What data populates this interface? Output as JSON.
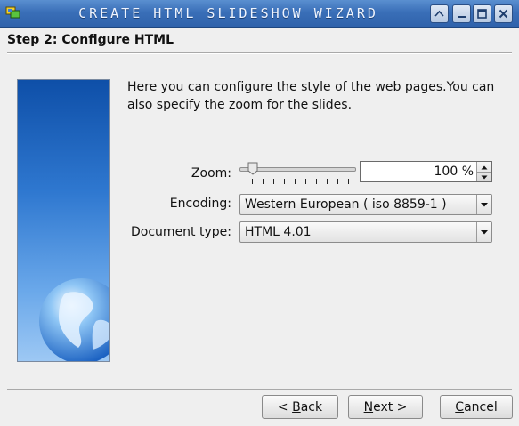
{
  "window": {
    "title": "Create HTML Slideshow Wizard",
    "controls": [
      "shade",
      "minimize",
      "maximize",
      "close"
    ]
  },
  "step": {
    "title": "Step 2: Configure HTML"
  },
  "description": "Here you can configure the style of the web pages.You can also specify the zoom for the slides.",
  "form": {
    "zoom": {
      "label": "Zoom:",
      "value": "100 %",
      "slider_level_fraction": 0.08
    },
    "encoding": {
      "label": "Encoding:",
      "selected": "Western European ( iso 8859-1 )"
    },
    "document_type": {
      "label": "Document type:",
      "selected": "HTML 4.01"
    }
  },
  "buttons": {
    "back": {
      "prefix": "< ",
      "mnemonic": "B",
      "rest": "ack"
    },
    "next": {
      "mnemonic": "N",
      "rest": "ext >"
    },
    "cancel": {
      "mnemonic": "C",
      "rest": "ancel"
    }
  },
  "icons": {
    "app": "slides-app-icon",
    "banner": "globe-icon"
  },
  "colors": {
    "titlebar": "#3a6fb8",
    "banner_top": "#0e4fa8",
    "banner_bottom": "#9dc8f4",
    "background": "#efefef"
  }
}
